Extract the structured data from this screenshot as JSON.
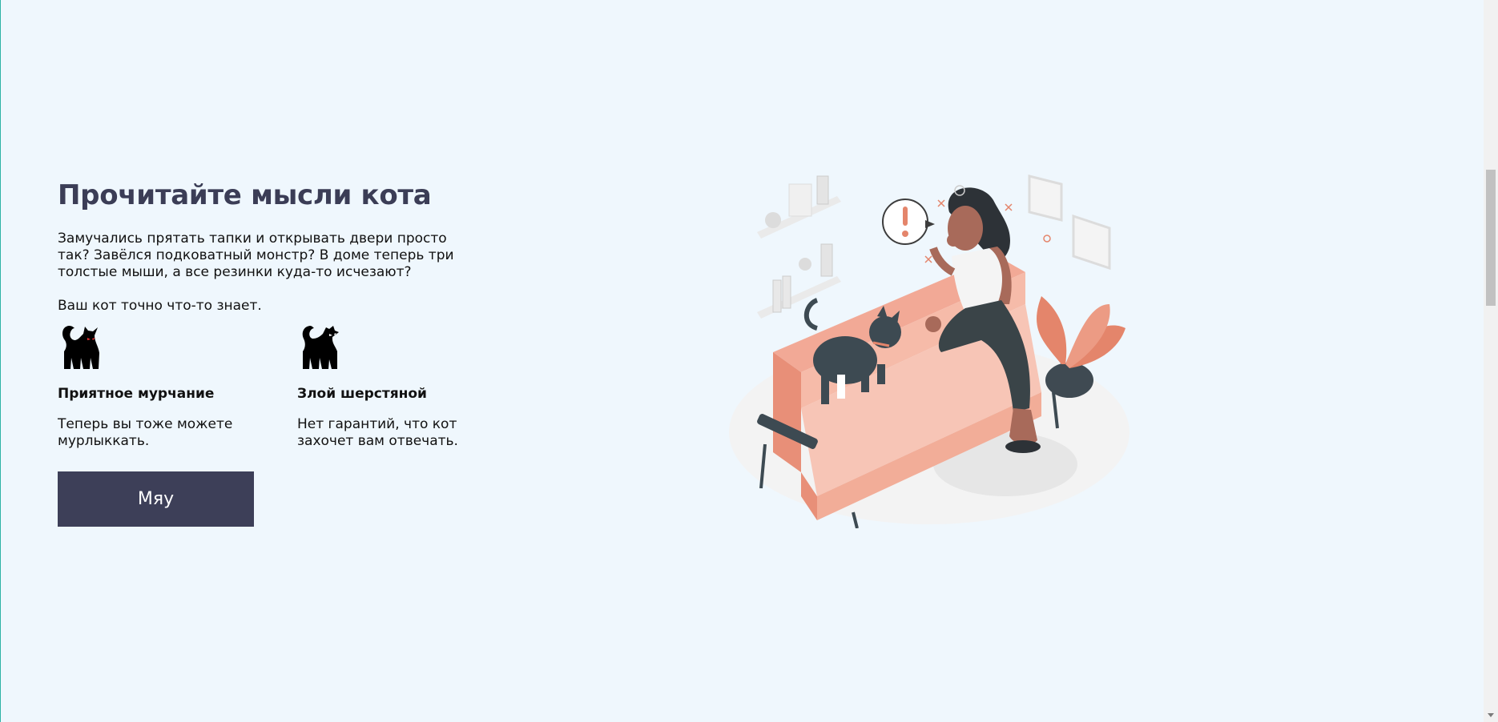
{
  "section": {
    "title": "Прочитайте мысли кота",
    "intro": "Замучались прятать тапки и открывать двери просто так? Завёлся подковатный монстр? В доме теперь три толстые мыши, а все резинки куда-то исчезают?",
    "intro2": "Ваш кот точно что-то знает.",
    "features": [
      {
        "icon": "black-cat-icon",
        "title": "Приятное мурчание",
        "text": "Теперь вы тоже можете мурлыккать."
      },
      {
        "icon": "angry-cat-icon",
        "title": "Злой шерстяной",
        "text": "Нет гарантий, что кот захочет вам отвечать."
      }
    ],
    "button_label": "Мяу"
  },
  "illustration": {
    "name": "woman-on-sofa-with-cat-illustration"
  },
  "colors": {
    "background": "#eff7fd",
    "title": "#3b3d56",
    "button": "#3d3f58",
    "accent": "#e4856b"
  }
}
